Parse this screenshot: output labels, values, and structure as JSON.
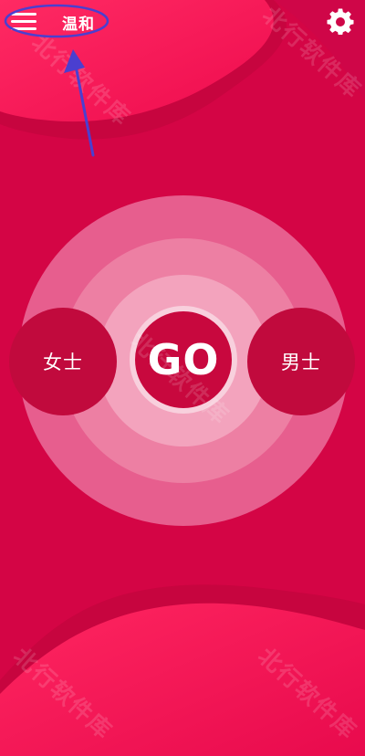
{
  "header": {
    "menu_icon": "hamburger-menu-icon",
    "mode_label": "温和",
    "settings_icon": "gear-icon"
  },
  "main": {
    "left_label": "女士",
    "go_label": "GO",
    "right_label": "男士"
  },
  "watermark": {
    "text": "北行软件库"
  },
  "colors": {
    "background": "#d40545",
    "wave_light": "#ff1a5a",
    "ring_outer": "#e75e8e",
    "ring_mid": "#ed7fa3",
    "ring_inner": "#f3a3bd",
    "button": "#c10a3d",
    "annotation": "#4a3fd0"
  }
}
